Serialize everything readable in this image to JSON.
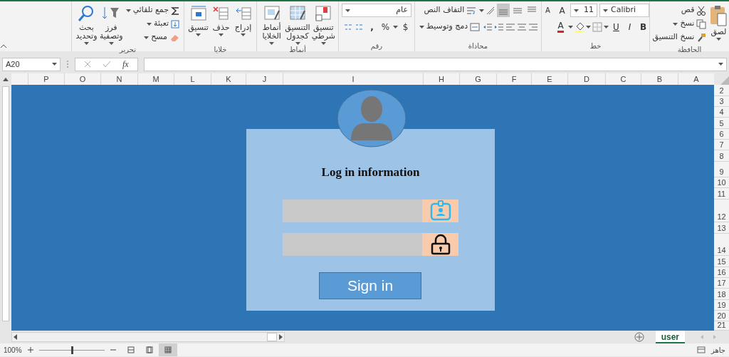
{
  "ribbon": {
    "clipboard": {
      "label": "الحافظة",
      "paste": "لصق",
      "cut": "قص",
      "copy": "نسخ",
      "format_painter": "نسخ التنسيق"
    },
    "font": {
      "label": "خط",
      "font_name": "Calibri",
      "font_size": "11",
      "grow_font": "A",
      "shrink_font": "A",
      "bold": "B",
      "italic": "I",
      "underline": "U",
      "font_color": "A"
    },
    "alignment": {
      "label": "محاذاة",
      "vertical_align": [
        {
          "kind": "top",
          "selected": false
        },
        {
          "kind": "middle",
          "selected": false
        },
        {
          "kind": "bottom",
          "selected": true
        }
      ],
      "wrap_text": "التفاف النص",
      "merge": "دمج وتوسيط"
    },
    "number": {
      "label": "رقم",
      "format": "عام",
      "currency": "$",
      "percent": "%",
      "comma": ","
    },
    "styles": {
      "label": "أنماط",
      "conditional": "تنسيق شرطي",
      "as_table": "التنسيق كجدول",
      "cell_styles": "أنماط الخلايا"
    },
    "cells": {
      "label": "خلايا",
      "insert": "إدراج",
      "delete": "حذف",
      "format": "تنسيق"
    },
    "editing": {
      "label": "تحرير",
      "autosum": "جمع تلقائي",
      "fill": "تعبئة",
      "clear": "مسح",
      "sort": "فرز وتصفية",
      "find": "بحث وتحديد"
    }
  },
  "formula_bar": {
    "name_box": "A20",
    "fx": "fx"
  },
  "columns": [
    "A",
    "B",
    "C",
    "D",
    "E",
    "F",
    "G",
    "H",
    "I",
    "J",
    "K",
    "L",
    "M",
    "N",
    "O",
    "P"
  ],
  "rows": [
    "2",
    "3",
    "4",
    "5",
    "6",
    "7",
    "8",
    "9",
    "10",
    "11",
    "12",
    "13",
    "14",
    "15",
    "16",
    "17",
    "18",
    "19",
    "20",
    "21"
  ],
  "login_form": {
    "title": "Log in information",
    "fields": [
      {
        "kind": "user"
      },
      {
        "kind": "password"
      }
    ],
    "button": "Sign in"
  },
  "sheet_tabs": [
    {
      "label": "user",
      "selected": true
    }
  ],
  "status_bar": {
    "status": "جاهز",
    "zoom": "100%",
    "zoom_slider": {
      "level": 0.5
    },
    "views": [
      {
        "kind": "page-break",
        "selected": false
      },
      {
        "kind": "page-layout",
        "selected": false
      },
      {
        "kind": "normal",
        "selected": true
      }
    ]
  }
}
